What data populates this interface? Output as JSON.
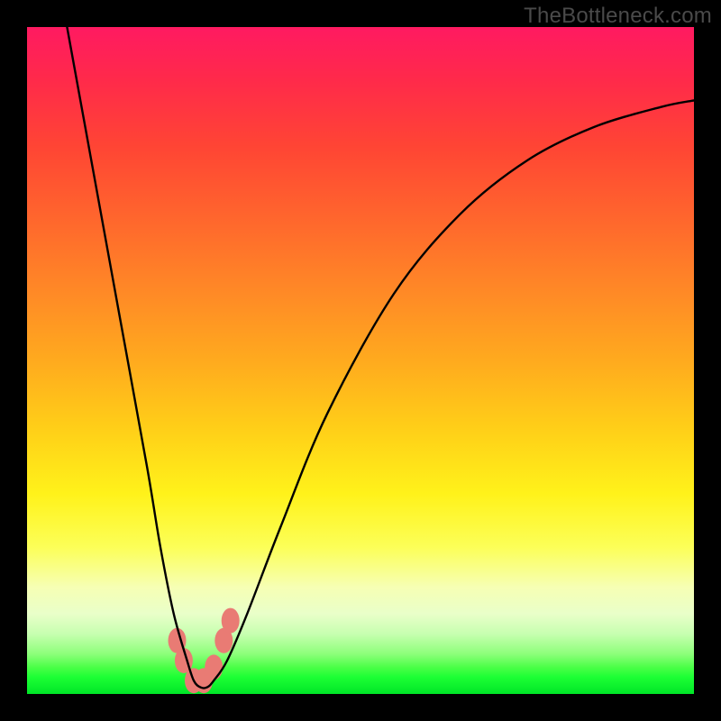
{
  "watermark": "TheBottleneck.com",
  "chart_data": {
    "type": "line",
    "title": "",
    "xlabel": "",
    "ylabel": "",
    "xlim": [
      0,
      100
    ],
    "ylim": [
      0,
      100
    ],
    "grid": false,
    "legend": false,
    "series": [
      {
        "name": "bottleneck-curve",
        "x": [
          6,
          10,
          14,
          18,
          20,
          22,
          24,
          25,
          26,
          27,
          28,
          30,
          33,
          38,
          45,
          55,
          65,
          75,
          85,
          95,
          100
        ],
        "values": [
          100,
          78,
          56,
          34,
          22,
          12,
          5,
          2,
          1,
          1,
          2,
          5,
          12,
          25,
          42,
          60,
          72,
          80,
          85,
          88,
          89
        ]
      }
    ],
    "markers": [
      {
        "name": "salmon-marker",
        "x": 22.5,
        "y": 8
      },
      {
        "name": "salmon-marker",
        "x": 23.5,
        "y": 5
      },
      {
        "name": "salmon-marker",
        "x": 25.0,
        "y": 2
      },
      {
        "name": "salmon-marker",
        "x": 26.5,
        "y": 2
      },
      {
        "name": "salmon-marker",
        "x": 28.0,
        "y": 4
      },
      {
        "name": "salmon-marker",
        "x": 29.5,
        "y": 8
      },
      {
        "name": "salmon-marker",
        "x": 30.5,
        "y": 11
      }
    ],
    "colors": {
      "curve": "#000000",
      "markers": "#e97b74",
      "gradient_top": "#ff1a61",
      "gradient_bottom": "#00e627"
    }
  }
}
